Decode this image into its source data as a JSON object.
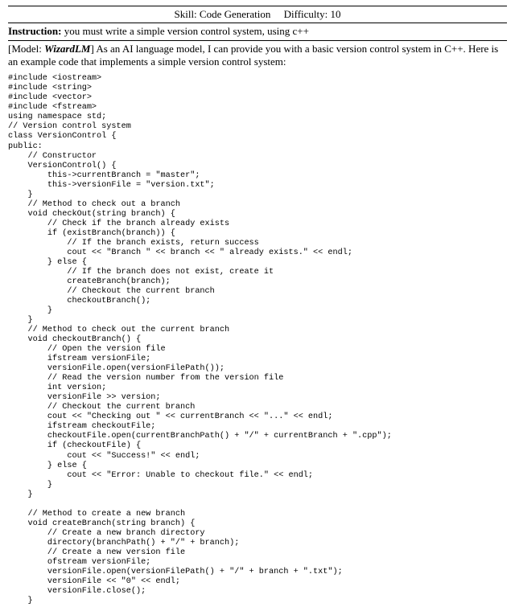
{
  "header": {
    "skill_label": "Skill:",
    "skill_value": "Code Generation",
    "difficulty_label": "Difficulty:",
    "difficulty_value": "10"
  },
  "instruction": {
    "label": "Instruction:",
    "text": "you must write a simple version control system, using c++"
  },
  "response": {
    "model_label": "[Model:",
    "model_name": "WizardLM",
    "model_close": "]",
    "intro": "As an AI language model, I can provide you with a basic version control system in C++. Here is an example code that implements a simple version control system:",
    "code": "#include <iostream>\n#include <string>\n#include <vector>\n#include <fstream>\nusing namespace std;\n// Version control system\nclass VersionControl {\npublic:\n    // Constructor\n    VersionControl() {\n        this->currentBranch = \"master\";\n        this->versionFile = \"version.txt\";\n    }\n    // Method to check out a branch\n    void checkOut(string branch) {\n        // Check if the branch already exists\n        if (existBranch(branch)) {\n            // If the branch exists, return success\n            cout << \"Branch \" << branch << \" already exists.\" << endl;\n        } else {\n            // If the branch does not exist, create it\n            createBranch(branch);\n            // Checkout the current branch\n            checkoutBranch();\n        }\n    }\n    // Method to check out the current branch\n    void checkoutBranch() {\n        // Open the version file\n        ifstream versionFile;\n        versionFile.open(versionFilePath());\n        // Read the version number from the version file\n        int version;\n        versionFile >> version;\n        // Checkout the current branch\n        cout << \"Checking out \" << currentBranch << \"...\" << endl;\n        ifstream checkoutFile;\n        checkoutFile.open(currentBranchPath() + \"/\" + currentBranch + \".cpp\");\n        if (checkoutFile) {\n            cout << \"Success!\" << endl;\n        } else {\n            cout << \"Error: Unable to checkout file.\" << endl;\n        }\n    }\n\n    // Method to create a new branch\n    void createBranch(string branch) {\n        // Create a new branch directory\n        directory(branchPath() + \"/\" + branch);\n        // Create a new version file\n        ofstream versionFile;\n        versionFile.open(versionFilePath() + \"/\" + branch + \".txt\");\n        versionFile << \"0\" << endl;\n        versionFile.close();\n    }"
  }
}
